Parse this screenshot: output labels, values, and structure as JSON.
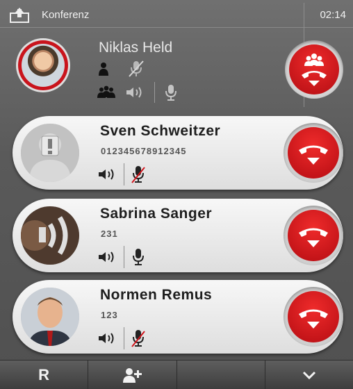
{
  "header": {
    "title": "Konferenz",
    "time": "02:14"
  },
  "host": {
    "name": "Niklas Held"
  },
  "participants": [
    {
      "name": "Sven Schweitzer",
      "number": "012345678912345",
      "mic_muted": true,
      "avatar": "placeholder"
    },
    {
      "name": "Sabrina Sanger",
      "number": "231",
      "mic_muted": false,
      "avatar": "speaking"
    },
    {
      "name": "Normen Remus",
      "number": "123",
      "mic_muted": true,
      "avatar": "photo"
    }
  ],
  "toolbar": {
    "r_label": "R",
    "add_participant_icon": "add-person-icon",
    "more_icon": "chevron-down-icon"
  },
  "colors": {
    "end_call_red": "#c8141b",
    "card_bg": "#ececec",
    "background": "#606060"
  }
}
